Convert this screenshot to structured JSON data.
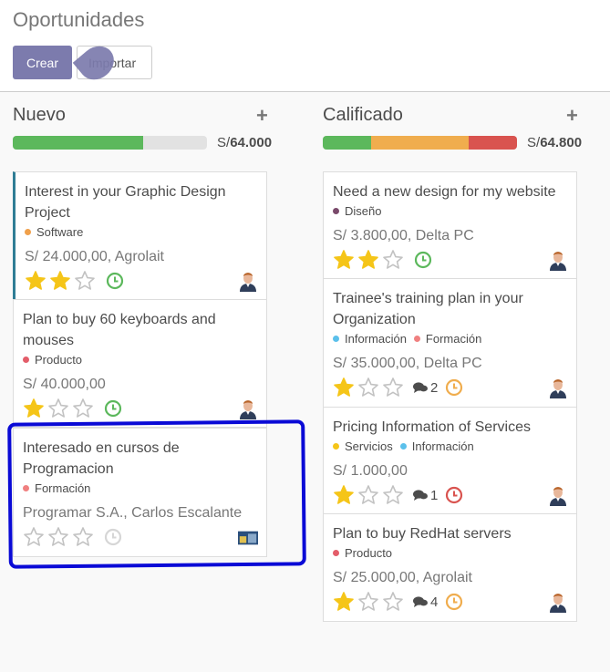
{
  "page": {
    "title": "Oportunidades"
  },
  "toolbar": {
    "create_label": "Crear",
    "import_label": "Importar"
  },
  "colors": {
    "accent": "#7c7bad",
    "tags": {
      "software": "#f0a04b",
      "producto": "#e35d6a",
      "formacion": "#f08080",
      "diseno": "#7a4a6b",
      "informacion": "#5bc0eb",
      "servicios": "#f5c518"
    },
    "progress": {
      "won": "#5cb85c",
      "warn": "#f0ad4e",
      "danger": "#d9534f",
      "empty": "#e2e2e2"
    },
    "star_on": "#f5c518",
    "star_off": "#c2c2c2",
    "clock_ok": "#5cb85c",
    "clock_warn": "#f0ad4e",
    "clock_late": "#d9534f",
    "clock_none": "#d6d6d6"
  },
  "columns": [
    {
      "title": "Nuevo",
      "currency": "S/",
      "total": "64.000",
      "progress": {
        "green": 0.67,
        "orange": 0,
        "red": 0
      },
      "cards": [
        {
          "name": "Interest in your Graphic Design Project",
          "tags": [
            {
              "label": "Software",
              "color": "software"
            }
          ],
          "revenue": "S/ 24.000,00, Agrolait",
          "stars": 2,
          "messages": "",
          "clock": "ok",
          "avatar": "person-avatar-icon",
          "left_border": true
        },
        {
          "name": "Plan to buy 60 keyboards and mouses",
          "tags": [
            {
              "label": "Producto",
              "color": "producto"
            }
          ],
          "revenue": "S/ 40.000,00",
          "stars": 1,
          "messages": "",
          "clock": "ok",
          "avatar": "person-avatar-icon",
          "left_border": false
        },
        {
          "name": "Interesado en cursos de Programacion",
          "tags": [
            {
              "label": "Formación",
              "color": "formacion"
            }
          ],
          "revenue": "Programar S.A., Carlos Escalante",
          "stars": 0,
          "messages": "",
          "clock": "none",
          "avatar": "company-image-icon",
          "left_border": false
        }
      ]
    },
    {
      "title": "Calificado",
      "currency": "S/",
      "total": "64.800",
      "progress": {
        "green": 0.25,
        "orange": 0.5,
        "red": 0.25
      },
      "cards": [
        {
          "name": "Need a new design for my website",
          "tags": [
            {
              "label": "Diseño",
              "color": "diseno"
            }
          ],
          "revenue": "S/ 3.800,00, Delta PC",
          "stars": 2,
          "messages": "",
          "clock": "ok",
          "avatar": "person-avatar-icon",
          "left_border": false
        },
        {
          "name": "Trainee's training plan in your Organization",
          "tags": [
            {
              "label": "Información",
              "color": "informacion"
            },
            {
              "label": "Formación",
              "color": "formacion"
            }
          ],
          "revenue": "S/ 35.000,00, Delta PC",
          "stars": 1,
          "messages": "2",
          "clock": "warn",
          "avatar": "person-avatar-icon",
          "left_border": false
        },
        {
          "name": "Pricing Information of Services",
          "tags": [
            {
              "label": "Servicios",
              "color": "servicios"
            },
            {
              "label": "Información",
              "color": "informacion"
            }
          ],
          "revenue": "S/ 1.000,00",
          "stars": 1,
          "messages": "1",
          "clock": "late",
          "avatar": "person-avatar-icon",
          "left_border": false
        },
        {
          "name": "Plan to buy RedHat servers",
          "tags": [
            {
              "label": "Producto",
              "color": "producto"
            }
          ],
          "revenue": "S/ 25.000,00, Agrolait",
          "stars": 1,
          "messages": "4",
          "clock": "warn",
          "avatar": "person-avatar-icon",
          "left_border": false
        }
      ]
    }
  ]
}
